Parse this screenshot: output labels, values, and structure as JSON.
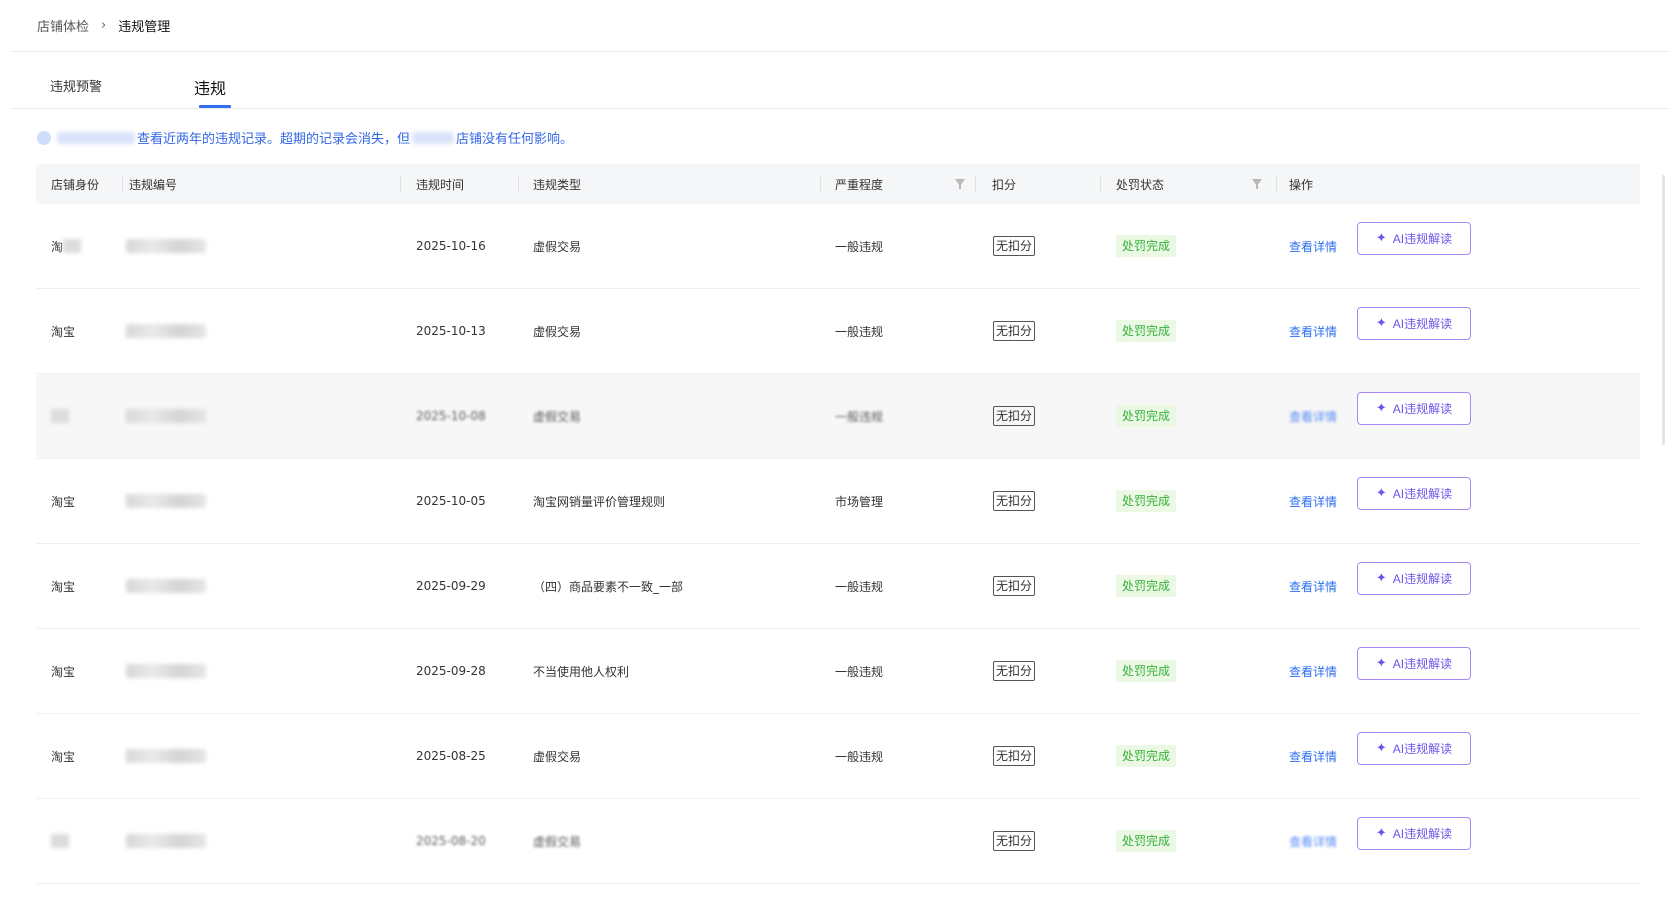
{
  "breadcrumb": {
    "parent": "店铺体检",
    "separator": "›",
    "current": "违规管理"
  },
  "tabs": [
    {
      "label": "违规预警",
      "active": false
    },
    {
      "label": "违规",
      "active": true
    }
  ],
  "notice": {
    "text_a": "查看近两年的违规记录。超期的记录会消失，但",
    "text_b": "店铺没有任何影响。"
  },
  "table": {
    "headers": {
      "shop_identity": "店铺身份",
      "violation_no": "违规编号",
      "violation_time": "违规时间",
      "violation_type": "违规类型",
      "severity": "严重程度",
      "deduction": "扣分",
      "penalty_status": "处罚状态",
      "actions": "操作"
    },
    "rows": [
      {
        "shop": "淘",
        "date": "2025-10-16",
        "type": "虚假交易",
        "severity": "一般违规",
        "score": "无扣分",
        "status": "处罚完成",
        "detail": "查看详情",
        "ai": "AI违规解读"
      },
      {
        "shop": "淘宝",
        "date": "2025-10-13",
        "type": "虚假交易",
        "severity": "一般违规",
        "score": "无扣分",
        "status": "处罚完成",
        "detail": "查看详情",
        "ai": "AI违规解读"
      },
      {
        "shop": "",
        "date": "2025-10-08",
        "type": "虚假交易",
        "severity": "一般违规",
        "score": "无扣分",
        "status": "处罚完成",
        "detail": "查看详情",
        "ai": "AI违规解读"
      },
      {
        "shop": "淘宝",
        "date": "2025-10-05",
        "type": "淘宝网销量评价管理规则",
        "severity": "市场管理",
        "score": "无扣分",
        "status": "处罚完成",
        "detail": "查看详情",
        "ai": "AI违规解读"
      },
      {
        "shop": "淘宝",
        "date": "2025-09-29",
        "type": "（四）商品要素不一致_一部",
        "severity": "一般违规",
        "score": "无扣分",
        "status": "处罚完成",
        "detail": "查看详情",
        "ai": "AI违规解读"
      },
      {
        "shop": "淘宝",
        "date": "2025-09-28",
        "type": "不当使用他人权利",
        "severity": "一般违规",
        "score": "无扣分",
        "status": "处罚完成",
        "detail": "查看详情",
        "ai": "AI违规解读"
      },
      {
        "shop": "淘宝",
        "date": "2025-08-25",
        "type": "虚假交易",
        "severity": "一般违规",
        "score": "无扣分",
        "status": "处罚完成",
        "detail": "查看详情",
        "ai": "AI违规解读"
      },
      {
        "shop": "",
        "date": "2025-08-20",
        "type": "虚假交易",
        "severity": "",
        "score": "无扣分",
        "status": "处罚完成",
        "detail": "查看详情",
        "ai": "AI违规解读"
      }
    ]
  },
  "colors": {
    "accent": "#2e6ff2",
    "ai_purple": "#6a55e8",
    "status_green": "#38b03b"
  }
}
